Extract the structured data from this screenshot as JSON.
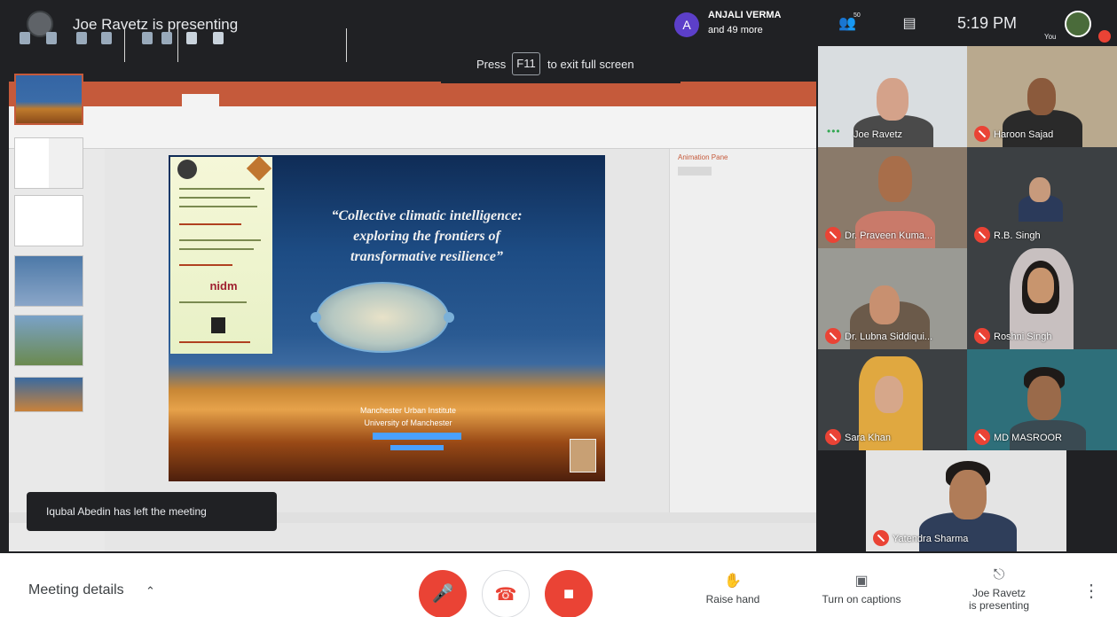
{
  "header": {
    "presenting_title": "Joe Ravetz is presenting",
    "participants_chip": {
      "avatar_letter": "A",
      "name": "ANJALI VERMA",
      "more": "and 49 more"
    },
    "time": "5:19 PM",
    "self_label": "You",
    "people_count": "50"
  },
  "fullscreen_hint": {
    "press": "Press",
    "key": "F11",
    "suffix": "to exit full screen"
  },
  "slide": {
    "title_line1": "“Collective climatic intelligence:",
    "title_line2": "exploring the frontiers of",
    "title_line3": "transformative resilience”",
    "logo_text": "nidm",
    "institute": "Manchester Urban Institute",
    "university": "University of Manchester",
    "animation_pane_title": "Animation Pane"
  },
  "toast": {
    "message": "Iqubal Abedin has left the meeting"
  },
  "participants": [
    {
      "name": "Joe Ravetz",
      "speaking": true
    },
    {
      "name": "Haroon Sajad",
      "muted": true
    },
    {
      "name": "Dr. Praveen Kuma...",
      "muted": true
    },
    {
      "name": "R.B. Singh",
      "muted": true
    },
    {
      "name": "Dr. Lubna Siddiqui...",
      "muted": true
    },
    {
      "name": "Roshni Singh",
      "muted": true
    },
    {
      "name": "Sara Khan",
      "muted": true
    },
    {
      "name": "MD MASROOR",
      "muted": true
    },
    {
      "name": "Yatendra Sharma",
      "muted": true
    }
  ],
  "bottom": {
    "meeting_details": "Meeting details",
    "raise_hand": "Raise hand",
    "captions": "Turn on captions",
    "presenting_line1": "Joe Ravetz",
    "presenting_line2": "is presenting"
  },
  "colors": {
    "accent_red": "#ea4335",
    "ppt_orange": "#c55a3b",
    "dark_bg": "#202124",
    "chip_purple": "#5c3fc9"
  }
}
